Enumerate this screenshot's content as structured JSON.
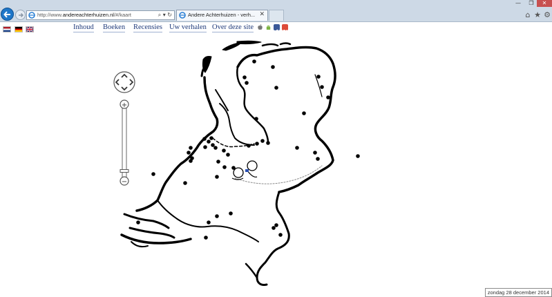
{
  "browser": {
    "url_prefix": "http://www.",
    "url_domain": "andereachterhuizen.nl",
    "url_path": "/#/kaart",
    "address_tools": "⌕ ▾ ↻",
    "tab_title": "Andere Achterhuizen - verh...",
    "tab_close": "✕",
    "window_min": "—",
    "window_max": "❐",
    "window_close": "✕",
    "home_icon": "⌂",
    "favorites_icon": "★",
    "settings_icon": "⚙"
  },
  "page": {
    "languages": [
      "nl",
      "de",
      "en"
    ],
    "menu": [
      "Inhoud",
      "Boeken",
      "Recensies",
      "Uw verhalen",
      "Over deze site"
    ],
    "social_icons": [
      "apple-icon",
      "android-icon",
      "facebook-icon",
      "google-plus-icon"
    ],
    "date_text": "zondag 28 december 2014"
  },
  "map": {
    "zoom_plus": "+",
    "zoom_minus": "−",
    "zoom_level": 0.08
  }
}
